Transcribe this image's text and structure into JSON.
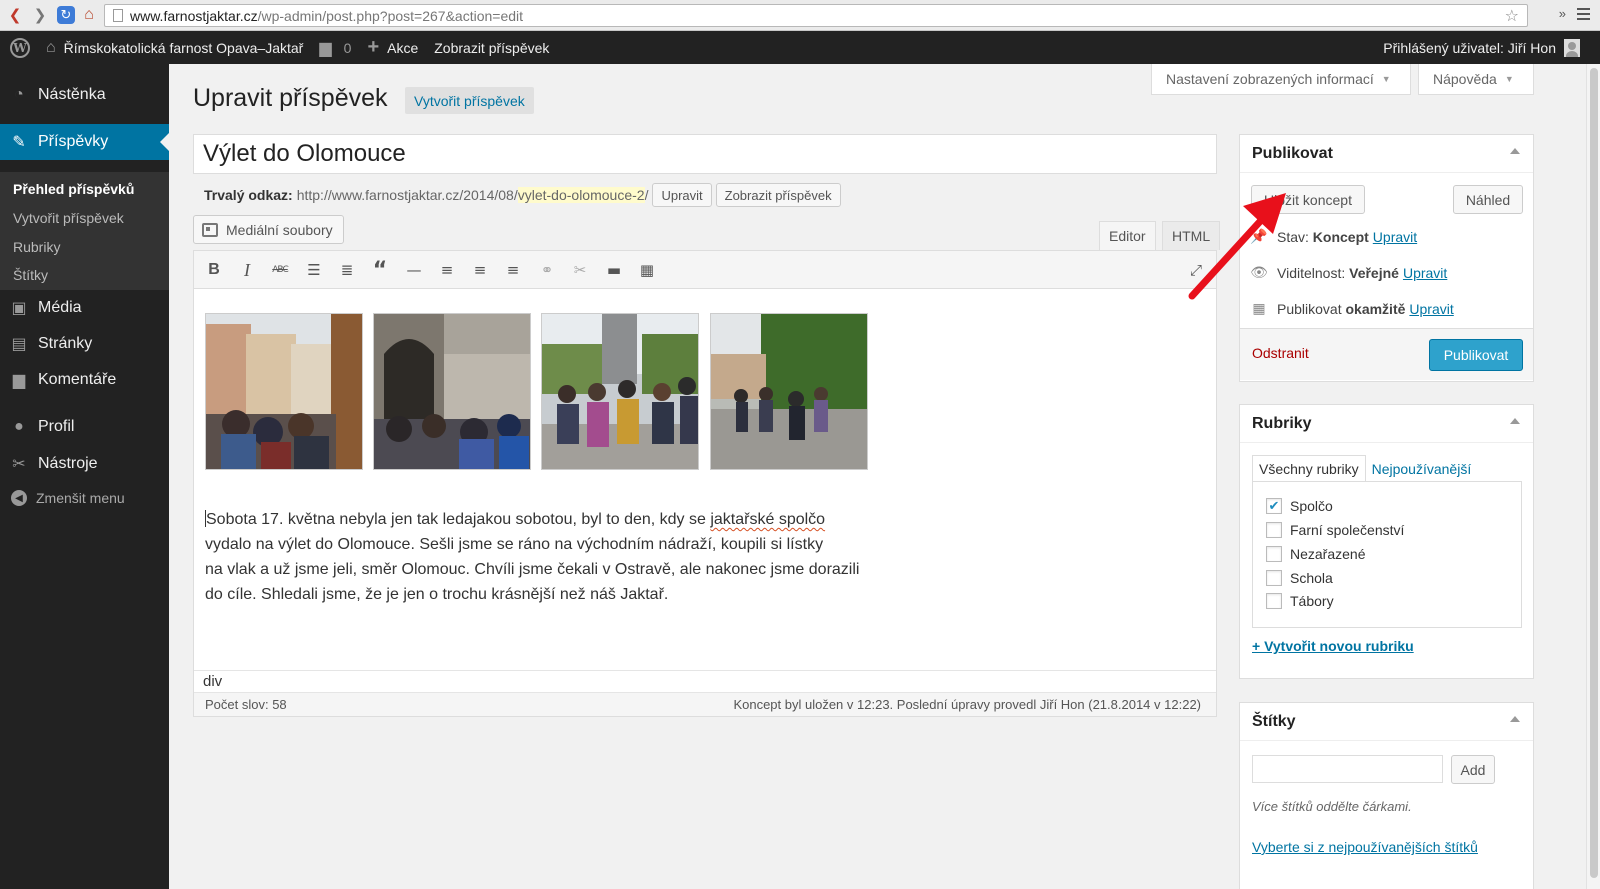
{
  "browser": {
    "url_host": "www.farnostjaktar.cz",
    "url_path": "/wp-admin/post.php?post=267&action=edit",
    "ext_label": "»"
  },
  "adminbar": {
    "site_name": "Římskokatolická farnost Opava–Jaktař",
    "comments_count": "0",
    "new_label": "Akce",
    "view_post_label": "Zobrazit příspěvek",
    "user_greeting": "Přihlášený uživatel: Jiří Hon"
  },
  "sidebar": {
    "dashboard": "Nástěnka",
    "posts": "Příspěvky",
    "sub": {
      "all_posts": "Přehled příspěvků",
      "add_new": "Vytvořit příspěvek",
      "categories": "Rubriky",
      "tags": "Štítky"
    },
    "media": "Média",
    "pages": "Stránky",
    "comments": "Komentáře",
    "profile": "Profil",
    "tools": "Nástroje",
    "collapse": "Zmenšit menu"
  },
  "screen_options": {
    "screen_label": "Nastavení zobrazených informací",
    "help_label": "Nápověda"
  },
  "page": {
    "title": "Upravit příspěvek",
    "add_new": "Vytvořit příspěvek"
  },
  "post": {
    "title": "Výlet do Olomouce",
    "permalink_label": "Trvalý odkaz:",
    "permalink_base": "http://www.farnostjaktar.cz/2014/08/",
    "permalink_slug": "vylet-do-olomouce-2",
    "permalink_end": "/",
    "edit_slug_btn": "Upravit",
    "view_post_btn": "Zobrazit příspěvek"
  },
  "editor": {
    "media_button": "Mediální soubory",
    "tab_visual": "Editor",
    "tab_html": "HTML",
    "content_start": "Sobota 17. května nebyla jen tak ledajakou sobotou, byl to den, kdy se ",
    "content_squiggle": "jaktařské spolčo",
    "content_line2": "vydalo na výlet do Olomouce. Sešli jsme se ráno na východním nádraží, koupili si lístky",
    "content_line3": "na vlak a už jsme jeli, směr Olomouc. Chvíli jsme čekali v Ostravě, ale nakonec jsme dorazili",
    "content_line4": "do cíle. Shledali jsme, že je jen o trochu krásnější než náš Jaktař.",
    "path": "div",
    "word_count": "Počet slov: 58",
    "autosave": "Koncept byl uložen v 12:23. Poslední úpravy provedl Jiří Hon (21.8.2014 v 12:22)"
  },
  "publish": {
    "title": "Publikovat",
    "save_draft": "Uložit koncept",
    "preview": "Náhled",
    "status_label": "Stav:",
    "status_value": "Koncept",
    "visibility_label": "Viditelnost:",
    "visibility_value": "Veřejné",
    "schedule_label": "Publikovat",
    "schedule_value": "okamžitě",
    "edit_link": "Upravit",
    "trash": "Odstranit",
    "publish_btn": "Publikovat"
  },
  "categories": {
    "title": "Rubriky",
    "tab_all": "Všechny rubriky",
    "tab_popular": "Nejpoužívanější",
    "items": [
      {
        "label": "Spolčo",
        "checked": "✔"
      },
      {
        "label": "Farní společenství",
        "checked": ""
      },
      {
        "label": "Nezařazené",
        "checked": ""
      },
      {
        "label": "Schola",
        "checked": ""
      },
      {
        "label": "Tábory",
        "checked": ""
      }
    ],
    "add_new": "+ Vytvořit novou rubriku"
  },
  "tags": {
    "title": "Štítky",
    "add_btn": "Add",
    "help": "Více štítků oddělte čárkami.",
    "cloud_link": "Vyberte si z nejpoužívanějších štítků"
  },
  "colors": {
    "accent": "#0074a2",
    "publish": "#2ea2cc",
    "annotation_arrow": "#e8101b"
  }
}
